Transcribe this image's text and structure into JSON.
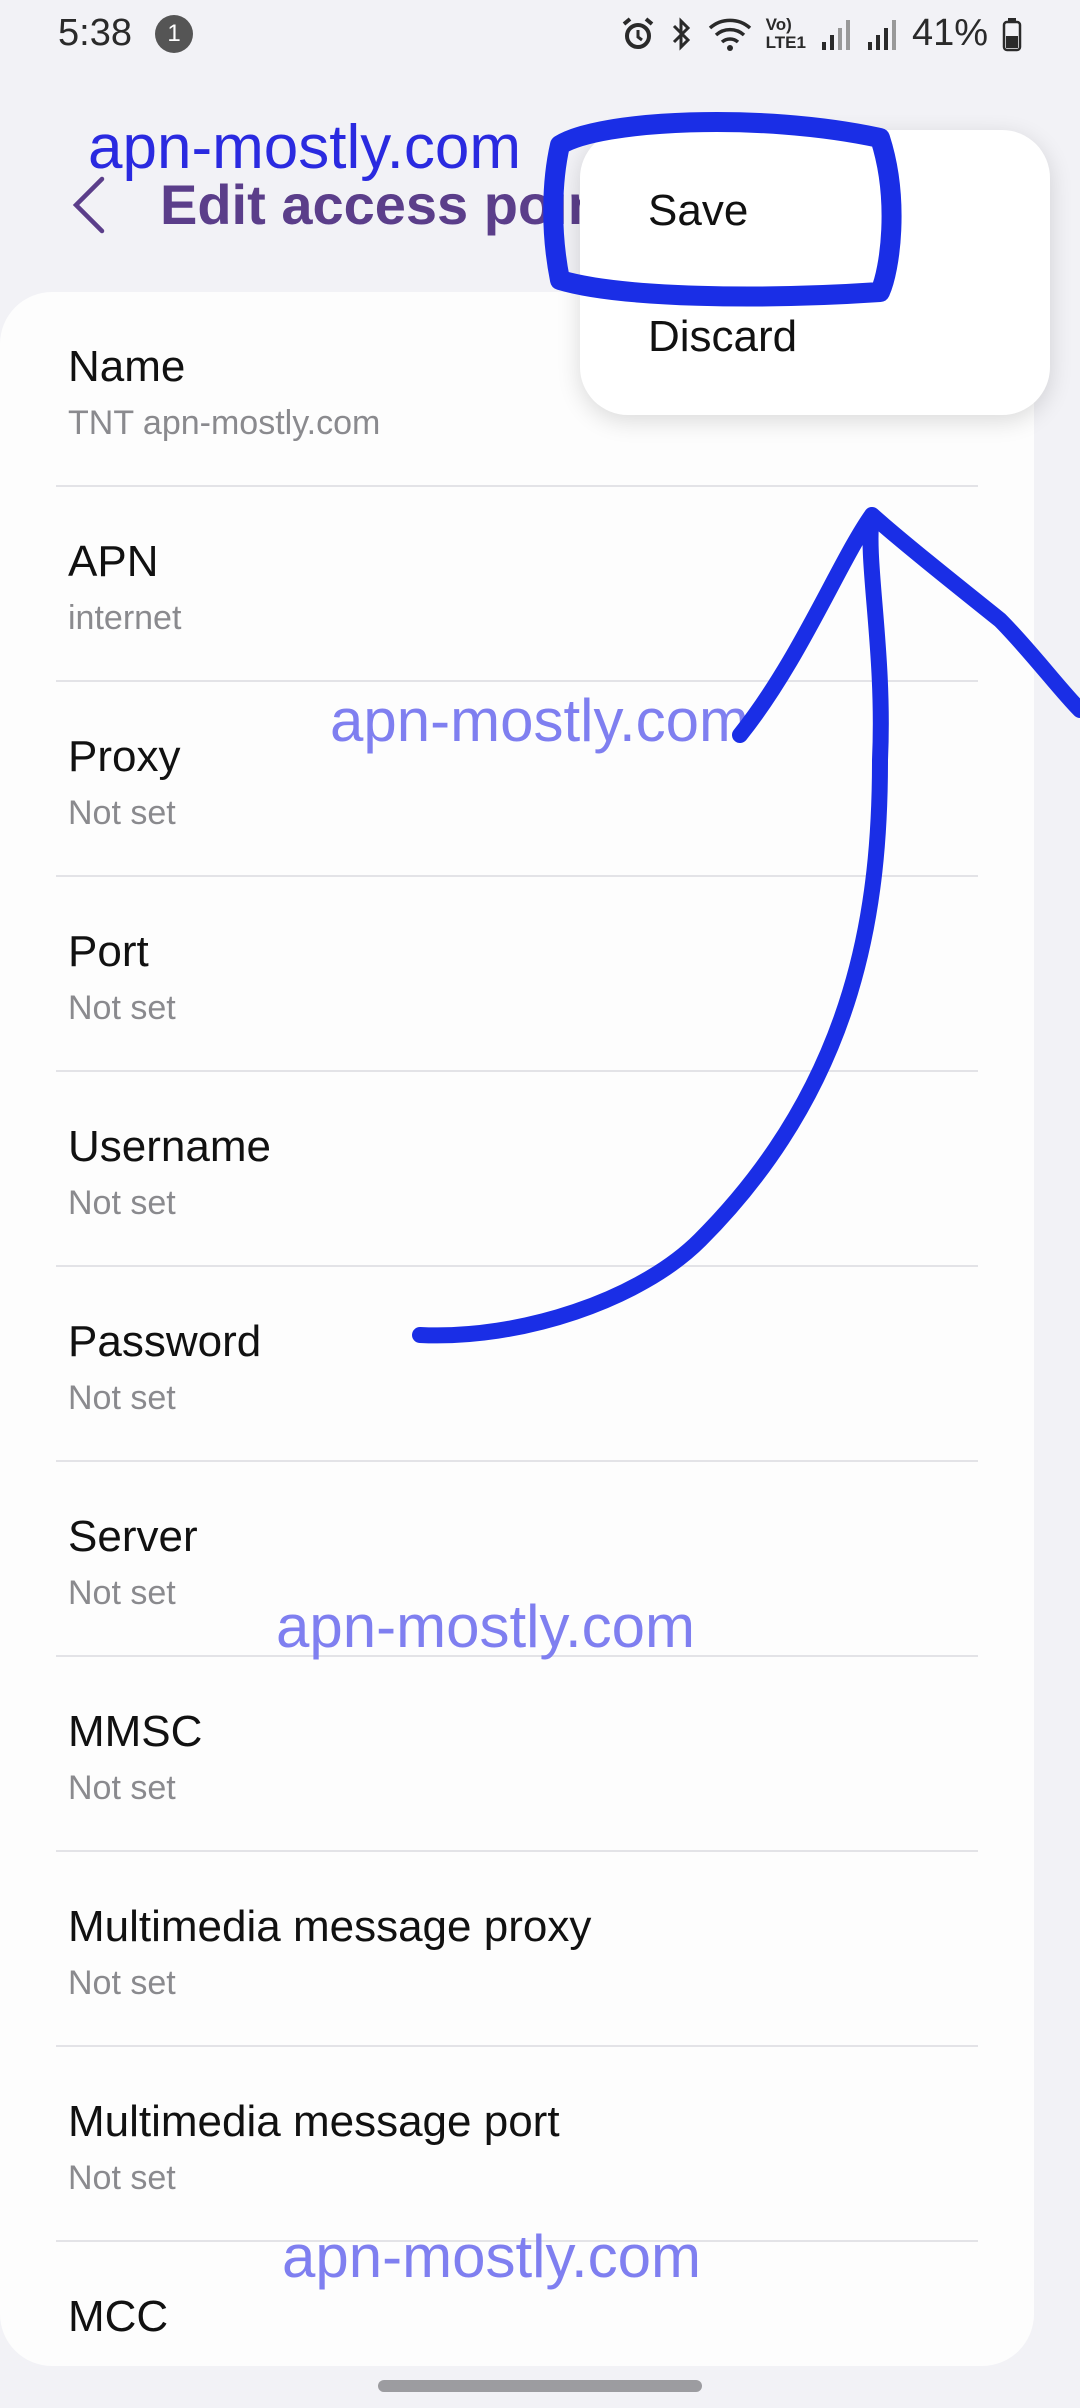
{
  "status": {
    "time": "5:38",
    "notification_count": "1",
    "network_label": "LTE1",
    "volte_label": "Vo)",
    "battery_percent": "41%"
  },
  "header": {
    "title": "Edit access point"
  },
  "menu": {
    "save_label": "Save",
    "discard_label": "Discard"
  },
  "watermark": {
    "text": "apn-mostly.com"
  },
  "fields": [
    {
      "label": "Name",
      "value": "TNT apn-mostly.com"
    },
    {
      "label": "APN",
      "value": "internet"
    },
    {
      "label": "Proxy",
      "value": "Not set"
    },
    {
      "label": "Port",
      "value": "Not set"
    },
    {
      "label": "Username",
      "value": "Not set"
    },
    {
      "label": "Password",
      "value": "Not set"
    },
    {
      "label": "Server",
      "value": "Not set"
    },
    {
      "label": "MMSC",
      "value": "Not set"
    },
    {
      "label": "Multimedia message proxy",
      "value": "Not set"
    },
    {
      "label": "Multimedia message port",
      "value": "Not set"
    },
    {
      "label": "MCC",
      "value": ""
    }
  ],
  "colors": {
    "title": "#5b3e8a",
    "annotation_stroke": "#1a2ee6",
    "watermark": "#7f7ff0",
    "background": "#f2f2f6"
  }
}
